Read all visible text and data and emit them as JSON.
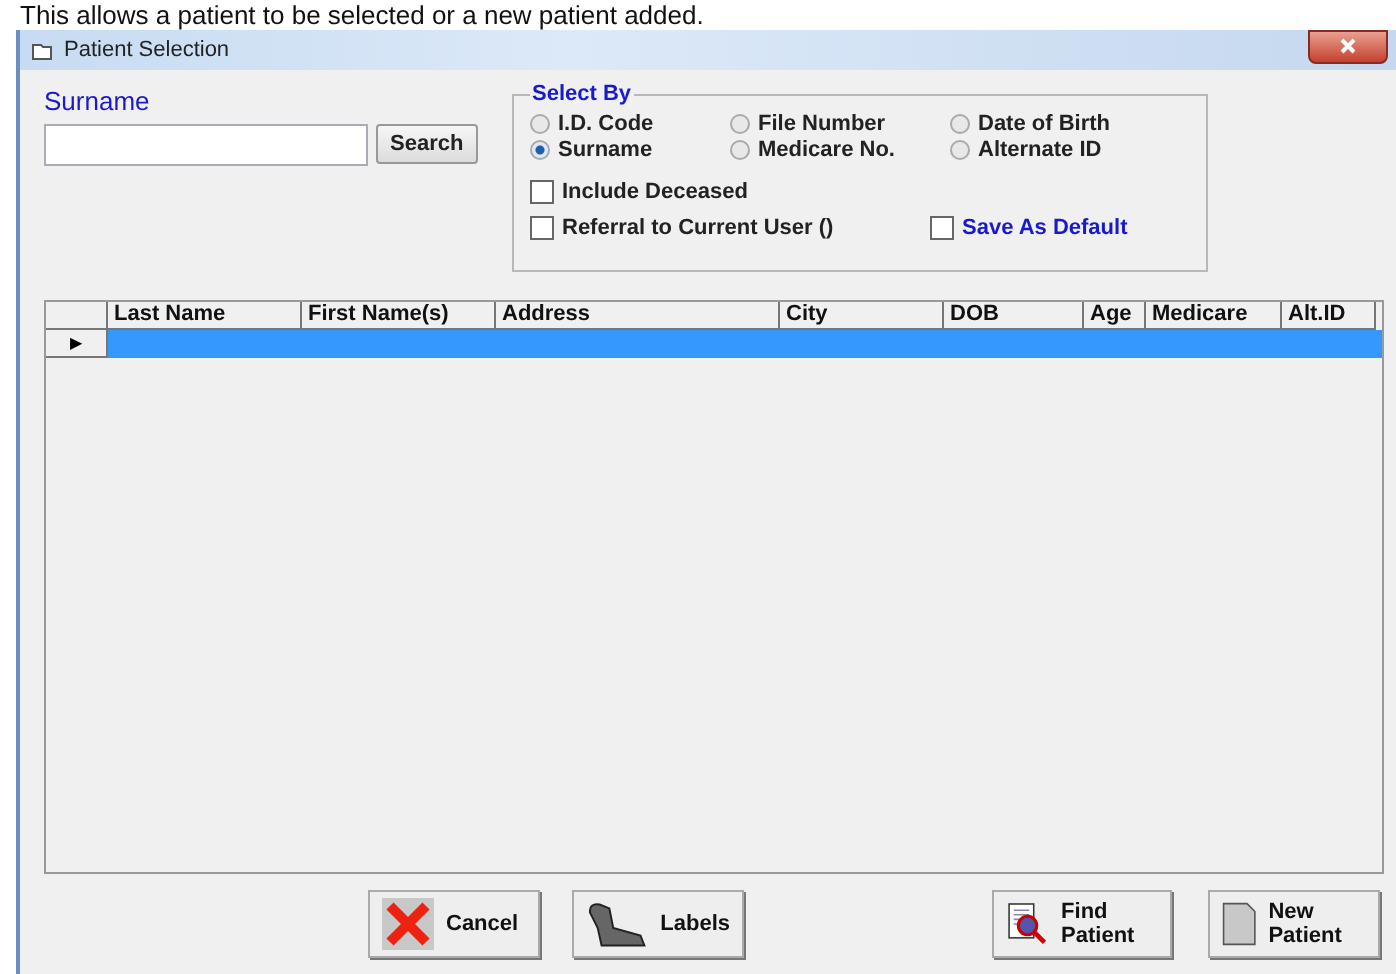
{
  "caption": "This allows a patient to be selected or a new patient added.",
  "window": {
    "title": "Patient Selection"
  },
  "search": {
    "label": "Surname",
    "button": "Search"
  },
  "select_by": {
    "title": "Select By",
    "options": [
      {
        "label": "I.D. Code",
        "selected": false
      },
      {
        "label": "Surname",
        "selected": true
      },
      {
        "label": "File Number",
        "selected": false
      },
      {
        "label": "Medicare No.",
        "selected": false
      },
      {
        "label": "Date of Birth",
        "selected": false
      },
      {
        "label": "Alternate ID",
        "selected": false
      }
    ],
    "checkboxes": [
      {
        "label": "Include Deceased",
        "checked": false,
        "kind": "plain"
      },
      {
        "label": "Referral to Current User ()",
        "checked": false,
        "kind": "plain"
      },
      {
        "label": "Save As Default",
        "checked": false,
        "kind": "accent"
      }
    ]
  },
  "table": {
    "columns": [
      "Last Name",
      "First Name(s)",
      "Address",
      "City",
      "DOB",
      "Age",
      "Medicare",
      "Alt.ID"
    ],
    "rows": [
      {
        "selected": true,
        "current": "▶"
      }
    ]
  },
  "buttons": [
    {
      "kind": "cancel",
      "label": "Cancel"
    },
    {
      "kind": "labels",
      "label": "Labels"
    },
    {
      "kind": "find",
      "label": "Find Patient"
    },
    {
      "kind": "new",
      "label": "New Patient"
    }
  ]
}
